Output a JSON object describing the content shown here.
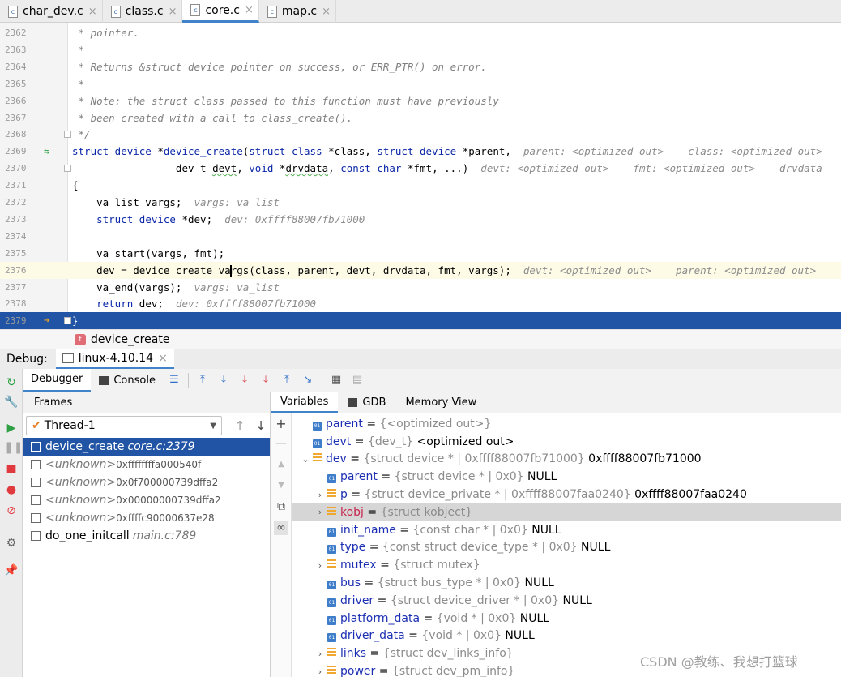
{
  "tabs": [
    {
      "label": "char_dev.c",
      "active": false
    },
    {
      "label": "class.c",
      "active": false
    },
    {
      "label": "core.c",
      "active": true
    },
    {
      "label": "map.c",
      "active": false
    }
  ],
  "editor": {
    "lines": [
      {
        "num": "2362",
        "html": "<span class=\"cm\"> * pointer.</span>"
      },
      {
        "num": "2363",
        "html": "<span class=\"cm\"> *</span>"
      },
      {
        "num": "2364",
        "html": "<span class=\"cm\"> * Returns &amp;struct device pointer on success, or ERR_PTR() on error.</span>"
      },
      {
        "num": "2365",
        "html": "<span class=\"cm\"> *</span>"
      },
      {
        "num": "2366",
        "html": "<span class=\"cm\"> * Note: the struct class passed to this function must have previously</span>"
      },
      {
        "num": "2367",
        "html": "<span class=\"cm\"> * been created with a call to class_create().</span>"
      },
      {
        "num": "2368",
        "html": "<span class=\"cm\"> */</span>"
      },
      {
        "num": "2369",
        "html": "<span class=\"kw\">struct device</span> *<span class=\"fn\">device_create</span>(<span class=\"kw\">struct class</span> *class, <span class=\"kw\">struct device</span> *parent,  <span class=\"hint\">parent: &lt;optimized out&gt;    class: &lt;optimized out&gt;</span>"
      },
      {
        "num": "2370",
        "html": "                 dev_t <span class=\"squig\">devt</span>, <span class=\"kw\">void</span> *<span class=\"squig\">drvdata</span>, <span class=\"kw\">const char</span> *fmt, ...)  <span class=\"hint\">devt: &lt;optimized out&gt;    fmt: &lt;optimized out&gt;    drvdata</span>"
      },
      {
        "num": "2371",
        "html": "{"
      },
      {
        "num": "2372",
        "html": "    va_list vargs;  <span class=\"hint\">vargs: va_list</span>"
      },
      {
        "num": "2373",
        "html": "    <span class=\"kw\">struct device</span> *dev;  <span class=\"hint\">dev: 0xffff88007fb71000</span>"
      },
      {
        "num": "2374",
        "html": ""
      },
      {
        "num": "2375",
        "html": "    va_start(vargs, fmt);"
      },
      {
        "num": "2376",
        "html": "    dev = device_create_va<span class=\"caret\"></span>rgs(class, parent, devt, drvdata, fmt, vargs);  <span class=\"hint\">devt: &lt;optimized out&gt;    parent: &lt;optimized out&gt;</span>"
      },
      {
        "num": "2377",
        "html": "    va_end(vargs);  <span class=\"hint\">vargs: va_list</span>"
      },
      {
        "num": "2378",
        "html": "    <span class=\"kw\">return</span> dev;  <span class=\"hint\">dev: 0xffff88007fb71000</span>"
      },
      {
        "num": "2379",
        "html": "}"
      }
    ]
  },
  "breadcrumb": {
    "label": "device_create"
  },
  "debug": {
    "label": "Debug:",
    "session": "linux-4.10.14",
    "debugger_tab": "Debugger",
    "console_tab": "Console",
    "frames_title": "Frames",
    "thread": "Thread-1",
    "frames": [
      {
        "name": "device_create",
        "loc": "core.c:2379",
        "unknown": false
      },
      {
        "name": "<unknown>",
        "addr": "0xffffffffa000540f",
        "unknown": true
      },
      {
        "name": "<unknown>",
        "addr": "0x0f700000739dffa2",
        "unknown": true
      },
      {
        "name": "<unknown>",
        "addr": "0x00000000739dffa2",
        "unknown": true
      },
      {
        "name": "<unknown>",
        "addr": "0xffffc90000637e28",
        "unknown": true
      },
      {
        "name": "do_one_initcall",
        "loc": "main.c:789",
        "unknown": false
      }
    ],
    "var_tabs": [
      "Variables",
      "GDB",
      "Memory View"
    ],
    "variables": [
      {
        "depth": 0,
        "exp": "",
        "icon": "field",
        "name": "parent",
        "eq": " = ",
        "type": "{<optimized out>}",
        "value": "",
        "hl": false
      },
      {
        "depth": 0,
        "exp": "",
        "icon": "field",
        "name": "devt",
        "eq": " = ",
        "type": "{dev_t}",
        "value": " <optimized out>",
        "hl": false
      },
      {
        "depth": 0,
        "exp": "v",
        "icon": "struct",
        "name": "dev",
        "eq": " = ",
        "type": "{struct device * | 0xffff88007fb71000}",
        "value": " 0xffff88007fb71000",
        "hl": false
      },
      {
        "depth": 1,
        "exp": "",
        "icon": "field",
        "name": "parent",
        "eq": " = ",
        "type": "{struct device * | 0x0}",
        "value": " NULL",
        "hl": false
      },
      {
        "depth": 1,
        "exp": ">",
        "icon": "struct",
        "name": "p",
        "eq": " = ",
        "type": "{struct device_private * | 0xffff88007faa0240}",
        "value": " 0xffff88007faa0240",
        "hl": false
      },
      {
        "depth": 1,
        "exp": ">",
        "icon": "struct",
        "name": "kobj",
        "eq": " = ",
        "type": "{struct kobject}",
        "value": "",
        "hl": true
      },
      {
        "depth": 1,
        "exp": "",
        "icon": "field",
        "name": "init_name",
        "eq": " = ",
        "type": "{const char * | 0x0}",
        "value": " NULL",
        "hl": false
      },
      {
        "depth": 1,
        "exp": "",
        "icon": "field",
        "name": "type",
        "eq": " = ",
        "type": "{const struct device_type * | 0x0}",
        "value": " NULL",
        "hl": false
      },
      {
        "depth": 1,
        "exp": ">",
        "icon": "struct",
        "name": "mutex",
        "eq": " = ",
        "type": "{struct mutex}",
        "value": "",
        "hl": false
      },
      {
        "depth": 1,
        "exp": "",
        "icon": "field",
        "name": "bus",
        "eq": " = ",
        "type": "{struct bus_type * | 0x0}",
        "value": " NULL",
        "hl": false
      },
      {
        "depth": 1,
        "exp": "",
        "icon": "field",
        "name": "driver",
        "eq": " = ",
        "type": "{struct device_driver * | 0x0}",
        "value": " NULL",
        "hl": false
      },
      {
        "depth": 1,
        "exp": "",
        "icon": "field",
        "name": "platform_data",
        "eq": " = ",
        "type": "{void * | 0x0}",
        "value": " NULL",
        "hl": false
      },
      {
        "depth": 1,
        "exp": "",
        "icon": "field",
        "name": "driver_data",
        "eq": " = ",
        "type": "{void * | 0x0}",
        "value": " NULL",
        "hl": false
      },
      {
        "depth": 1,
        "exp": ">",
        "icon": "struct",
        "name": "links",
        "eq": " = ",
        "type": "{struct dev_links_info}",
        "value": "",
        "hl": false
      },
      {
        "depth": 1,
        "exp": ">",
        "icon": "struct",
        "name": "power",
        "eq": " = ",
        "type": "{struct dev_pm_info}",
        "value": "",
        "hl": false
      }
    ]
  },
  "watermark": "CSDN @教练、我想打篮球"
}
